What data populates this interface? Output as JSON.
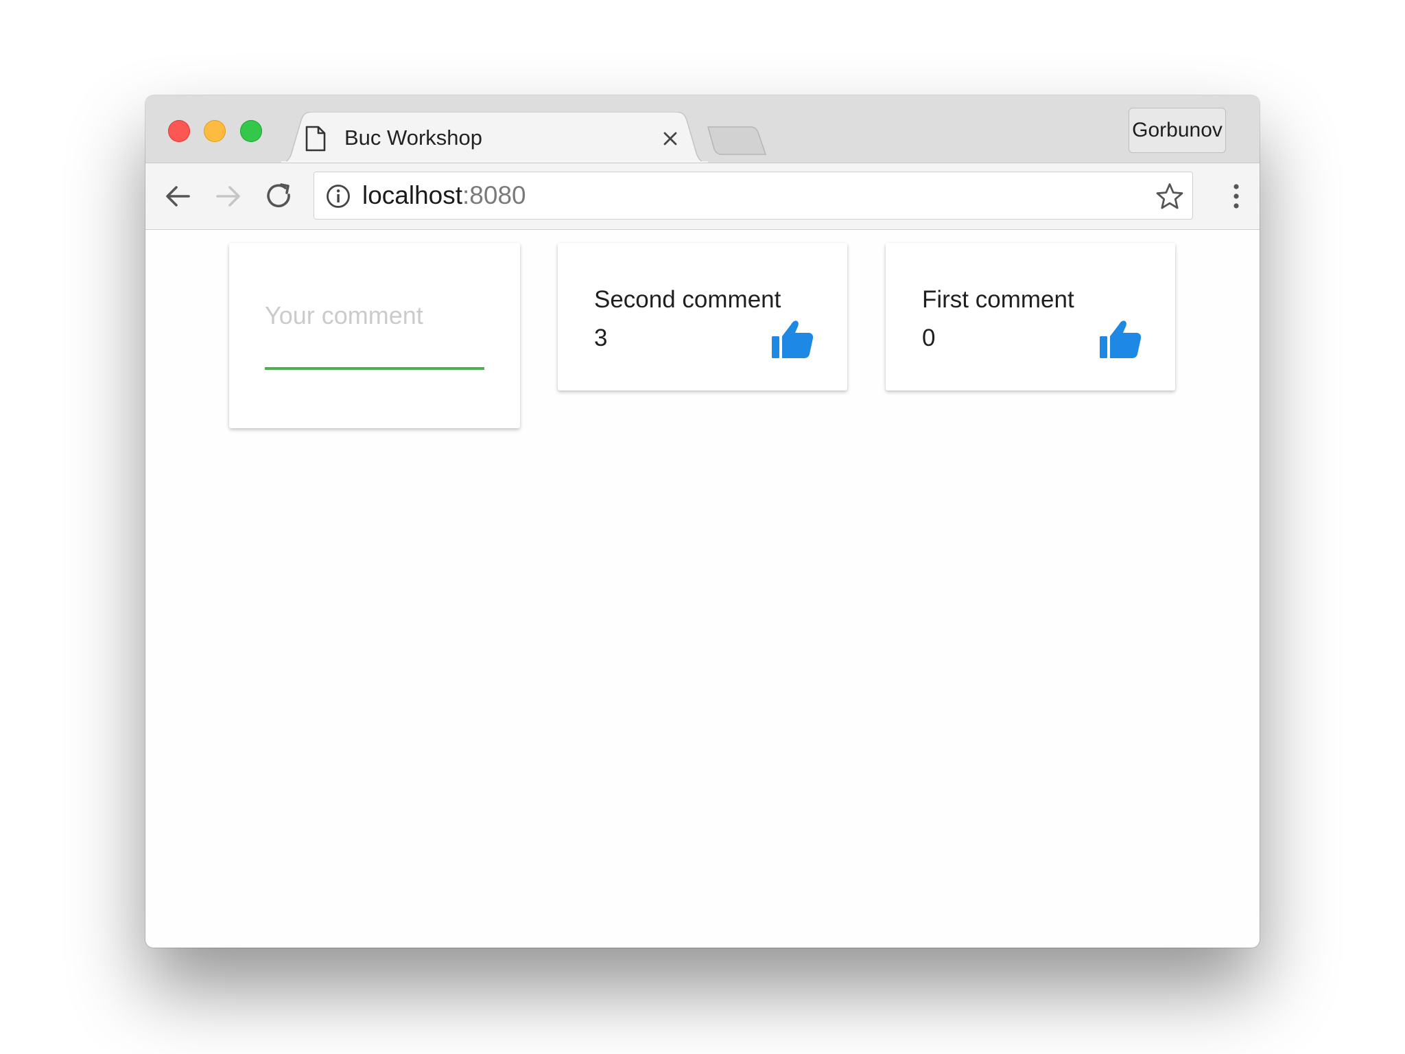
{
  "browser": {
    "tab_title": "Buc Workshop",
    "profile_name": "Gorbunov",
    "url_host": "localhost",
    "url_port": ":8080"
  },
  "comment_form": {
    "placeholder": "Your comment",
    "value": ""
  },
  "comments": [
    {
      "text": "Second comment",
      "likes": "3"
    },
    {
      "text": "First comment",
      "likes": "0"
    }
  ],
  "colors": {
    "accent_green": "#4caf50",
    "like_blue": "#1e88e5"
  },
  "icons": {
    "tab": "page-icon",
    "close": "close-icon",
    "back": "back-arrow-icon",
    "forward": "forward-arrow-icon",
    "reload": "reload-icon",
    "info": "info-icon",
    "bookmark": "star-icon",
    "menu": "kebab-menu-icon",
    "like": "thumbs-up-icon"
  }
}
